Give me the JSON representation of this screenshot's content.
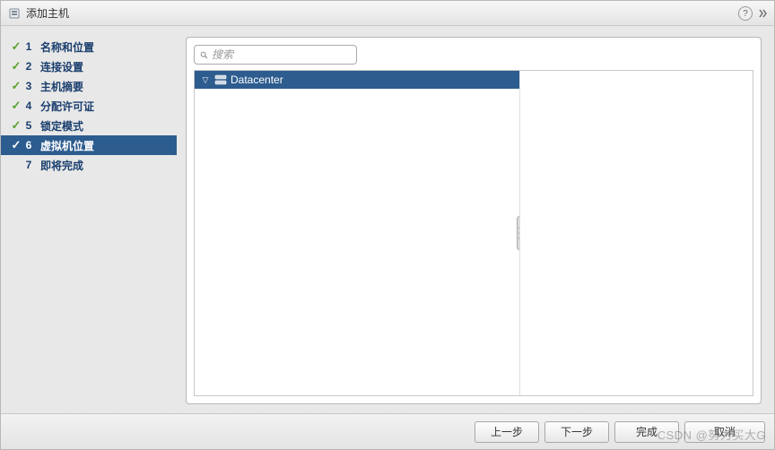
{
  "title": "添加主机",
  "help_text": "?",
  "steps": [
    {
      "num": "1",
      "label": "名称和位置",
      "done": true,
      "active": false
    },
    {
      "num": "2",
      "label": "连接设置",
      "done": true,
      "active": false
    },
    {
      "num": "3",
      "label": "主机摘要",
      "done": true,
      "active": false
    },
    {
      "num": "4",
      "label": "分配许可证",
      "done": true,
      "active": false
    },
    {
      "num": "5",
      "label": "锁定模式",
      "done": true,
      "active": false
    },
    {
      "num": "6",
      "label": "虚拟机位置",
      "done": true,
      "active": true
    },
    {
      "num": "7",
      "label": "即将完成",
      "done": false,
      "active": false
    }
  ],
  "search": {
    "placeholder": "搜索"
  },
  "tree": {
    "root": {
      "label": "Datacenter"
    }
  },
  "buttons": {
    "back": "上一步",
    "next": "下一步",
    "finish": "完成",
    "cancel": "取消"
  },
  "watermark": "CSDN @努力买大G"
}
